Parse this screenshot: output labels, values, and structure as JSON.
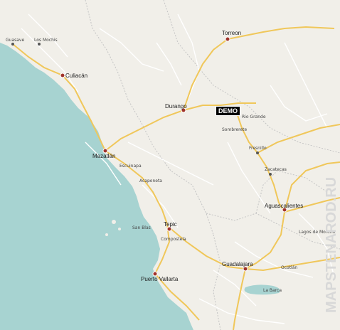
{
  "map": {
    "colors": {
      "sea": "#a7d3d1",
      "land": "#f1efe9",
      "road_major": "#f3d27a",
      "road_minor": "#ffffff",
      "border": "#b9b9b9",
      "lake": "#a7d3d1"
    },
    "cities": [
      {
        "name": "Culiacán",
        "kind": "major"
      },
      {
        "name": "Durango",
        "kind": "major"
      },
      {
        "name": "Mazatlán",
        "kind": "major"
      },
      {
        "name": "Tepic",
        "kind": "major"
      },
      {
        "name": "Aguascalientes",
        "kind": "major"
      },
      {
        "name": "Guadalajara",
        "kind": "major"
      },
      {
        "name": "Puerto Vallarta",
        "kind": "major"
      },
      {
        "name": "Torreon",
        "kind": "major"
      },
      {
        "name": "Fresnillo",
        "kind": "town"
      },
      {
        "name": "Zacatecas",
        "kind": "town"
      },
      {
        "name": "Guasave",
        "kind": "town"
      },
      {
        "name": "Los Mochis",
        "kind": "town"
      },
      {
        "name": "Sombrerete",
        "kind": "town"
      },
      {
        "name": "Rio Grande",
        "kind": "town"
      },
      {
        "name": "Compostela",
        "kind": "town"
      },
      {
        "name": "Escuinapa",
        "kind": "town"
      },
      {
        "name": "Acaponeta",
        "kind": "town"
      },
      {
        "name": "San Blas",
        "kind": "town"
      },
      {
        "name": "Lagos de Moreno",
        "kind": "town"
      },
      {
        "name": "La Barca",
        "kind": "town"
      },
      {
        "name": "Ocotlán",
        "kind": "town"
      }
    ],
    "demo_label": "DEMO",
    "watermark": "MAPSTENAROD.RU"
  }
}
